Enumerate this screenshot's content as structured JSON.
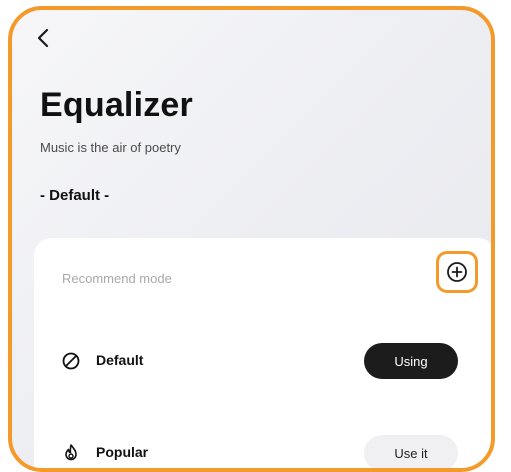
{
  "header": {
    "back_icon": "chevron-left-icon",
    "title": "Equalizer",
    "subtitle": "Music is the air of poetry",
    "current_preset": "- Default -"
  },
  "panel": {
    "section_label": "Recommend mode",
    "add_icon": "plus-circle-icon",
    "modes": [
      {
        "label": "Default",
        "icon": "circle-slash-icon",
        "action": "Using",
        "active": true
      },
      {
        "label": "Popular",
        "icon": "flame-icon",
        "action": "Use it",
        "active": false
      }
    ]
  },
  "colors": {
    "highlight": "#f39a2b",
    "active_pill": "#1c1c1c",
    "inactive_pill": "#f0f0f2"
  }
}
